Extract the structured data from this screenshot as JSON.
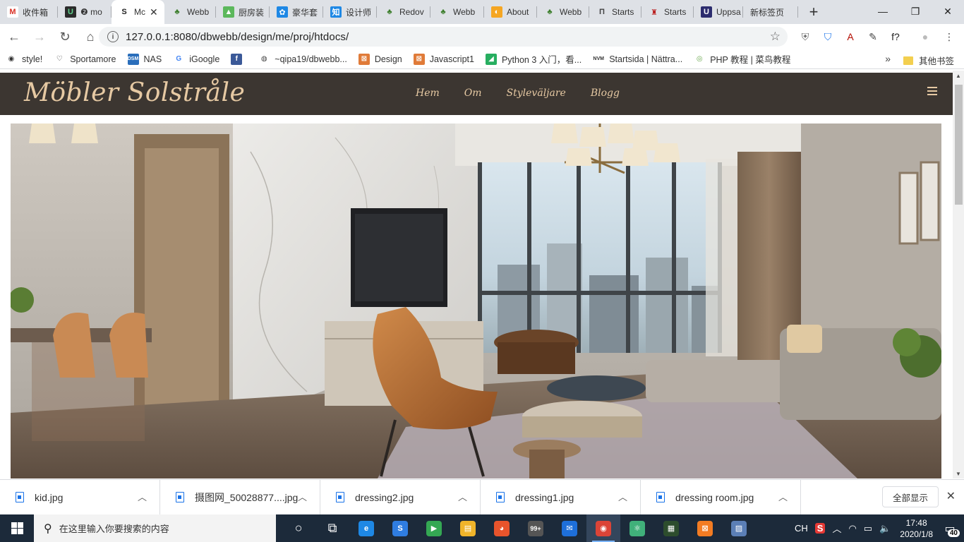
{
  "browser": {
    "tabs": [
      {
        "label": "收件箱",
        "fav": "M",
        "fav_color": "#ffffff",
        "fav_fg": "#d93025",
        "width": 82
      },
      {
        "label": "❷ mo",
        "fav": "U",
        "fav_color": "#2b2b2b",
        "fav_fg": "#5fd38d",
        "width": 76
      },
      {
        "label": "Mc",
        "fav": "S",
        "fav_color": "transparent",
        "fav_fg": "#222",
        "width": 75,
        "active": true
      },
      {
        "label": "Webb",
        "fav": "♣",
        "fav_color": "transparent",
        "fav_fg": "#3a7d2a",
        "width": 73
      },
      {
        "label": "厨房装",
        "fav": "▲",
        "fav_color": "#5cb85c",
        "fav_fg": "#fff",
        "width": 76
      },
      {
        "label": "豪华套",
        "fav": "✿",
        "fav_color": "#1e88e5",
        "fav_fg": "#fff",
        "width": 76
      },
      {
        "label": "设计师",
        "fav": "知",
        "fav_color": "#1e88e5",
        "fav_fg": "#fff",
        "width": 76
      },
      {
        "label": "Redov",
        "fav": "♣",
        "fav_color": "transparent",
        "fav_fg": "#3a7d2a",
        "width": 76
      },
      {
        "label": "Webb",
        "fav": "♣",
        "fav_color": "transparent",
        "fav_fg": "#3a7d2a",
        "width": 76
      },
      {
        "label": "About",
        "fav": "◐",
        "fav_color": "#f5a623",
        "fav_fg": "#fff",
        "width": 75
      },
      {
        "label": "Webb",
        "fav": "♣",
        "fav_color": "transparent",
        "fav_fg": "#3a7d2a",
        "width": 74
      },
      {
        "label": "Starts",
        "fav": "Π",
        "fav_color": "transparent",
        "fav_fg": "#444",
        "width": 74
      },
      {
        "label": "Starts",
        "fav": "♜",
        "fav_color": "transparent",
        "fav_fg": "#b22",
        "width": 74
      },
      {
        "label": "Uppsa",
        "fav": "U",
        "fav_color": "#2c2c6e",
        "fav_fg": "#fff",
        "width": 70
      },
      {
        "label": "新标签页",
        "fav": "",
        "fav_color": "transparent",
        "fav_fg": "#444",
        "width": 78
      }
    ],
    "active_tab_close": "✕",
    "new_tab": "+",
    "window_controls": {
      "minimize": "—",
      "maximize": "❐",
      "close": "✕"
    },
    "toolbar": {
      "back": "←",
      "forward": "→",
      "reload": "↻",
      "home": "⌂",
      "url": "127.0.0.1:8080/dbwebb/design/me/proj/htdocs/",
      "info": "i",
      "star": "☆"
    },
    "extensions": [
      {
        "icon": "shield-badge-icon",
        "glyph": "⛨",
        "color": "#666"
      },
      {
        "icon": "shield-check-icon",
        "glyph": "⛉",
        "color": "#1a73e8"
      },
      {
        "icon": "pdf-icon",
        "glyph": "A",
        "color": "#b30b00"
      },
      {
        "icon": "eyedropper-icon",
        "glyph": "✎",
        "color": "#444"
      },
      {
        "icon": "font-finder-icon",
        "glyph": "f?",
        "color": "#222"
      },
      {
        "icon": "profile-avatar-icon",
        "glyph": "●",
        "color": "#bbb"
      },
      {
        "icon": "menu-kebab-icon",
        "glyph": "⋮",
        "color": "#444"
      }
    ],
    "bookmarks": [
      {
        "label": "style!",
        "glyph": "◉",
        "bg": "transparent",
        "fg": "#333"
      },
      {
        "label": "Sportamore",
        "glyph": "♡",
        "bg": "transparent",
        "fg": "#333"
      },
      {
        "label": "NAS",
        "glyph": "DSM",
        "bg": "#2a6ebb",
        "fg": "#fff"
      },
      {
        "label": "iGoogle",
        "glyph": "G",
        "bg": "transparent",
        "fg": "#4285f4"
      },
      {
        "label": "",
        "glyph": "f",
        "bg": "#3b5998",
        "fg": "#fff"
      },
      {
        "label": "~qipa19/dbwebb...",
        "glyph": "◍",
        "bg": "transparent",
        "fg": "#444"
      },
      {
        "label": "Design",
        "glyph": "⊠",
        "bg": "#e07b39",
        "fg": "#fff"
      },
      {
        "label": "Javascript1",
        "glyph": "⊠",
        "bg": "#e07b39",
        "fg": "#fff"
      },
      {
        "label": "Python 3 入门，看...",
        "glyph": "◢",
        "bg": "#27ae60",
        "fg": "#fff"
      },
      {
        "label": "Startsida | Nättra...",
        "glyph": "NVM",
        "bg": "transparent",
        "fg": "#333"
      },
      {
        "label": "PHP 教程 | 菜鸟教程",
        "glyph": "◎",
        "bg": "transparent",
        "fg": "#6aa84f"
      }
    ],
    "bookmarks_more": "»",
    "bookmarks_other": "其他书签"
  },
  "site": {
    "logo": "Möbler Solstråle",
    "nav": [
      "Hem",
      "Om",
      "Styleväljare",
      "Blogg"
    ],
    "accent": "#e6c9a3",
    "header_bg": "#3c3631"
  },
  "downloads": {
    "items": [
      "kid.jpg",
      "摄图网_50028877....jpg",
      "dressing2.jpg",
      "dressing1.jpg",
      "dressing room.jpg"
    ],
    "chevron": "︿",
    "show_all": "全部显示",
    "close": "✕"
  },
  "taskbar": {
    "search_placeholder": "在这里输入你要搜索的内容",
    "apps": [
      {
        "icon": "cortana-icon",
        "glyph": "○",
        "bg": "transparent"
      },
      {
        "icon": "task-view-icon",
        "glyph": "⧉",
        "bg": "transparent"
      },
      {
        "icon": "edge-icon",
        "glyph": "e",
        "bg": "#1e88e5"
      },
      {
        "icon": "sogou-icon",
        "glyph": "S",
        "bg": "#2f7de1"
      },
      {
        "icon": "media-player-icon",
        "glyph": "▶",
        "bg": "#34a853"
      },
      {
        "icon": "file-explorer-icon",
        "glyph": "▤",
        "bg": "#f0b42a"
      },
      {
        "icon": "firefox-icon",
        "glyph": "◕",
        "bg": "#e8542c"
      },
      {
        "icon": "store-badge-icon",
        "glyph": "99+",
        "bg": "#555"
      },
      {
        "icon": "thunderbird-icon",
        "glyph": "✉",
        "bg": "#1e6fd9"
      },
      {
        "icon": "chrome-icon",
        "glyph": "◉",
        "bg": "#db4437",
        "active": true
      },
      {
        "icon": "atom-icon",
        "glyph": "⚛",
        "bg": "#40b07a"
      },
      {
        "icon": "terminal-icon",
        "glyph": "▦",
        "bg": "#2d4d2d"
      },
      {
        "icon": "xampp-icon",
        "glyph": "⊠",
        "bg": "#f37c23"
      },
      {
        "icon": "image-editor-icon",
        "glyph": "▨",
        "bg": "#5b7fb6"
      }
    ],
    "tray": {
      "ime": "CH",
      "sogou": "S",
      "chevron": "︿",
      "network": "◠",
      "battery": "▭",
      "volume": "🔈",
      "time": "17:48",
      "date": "2020/1/8",
      "notifications": "40"
    }
  }
}
